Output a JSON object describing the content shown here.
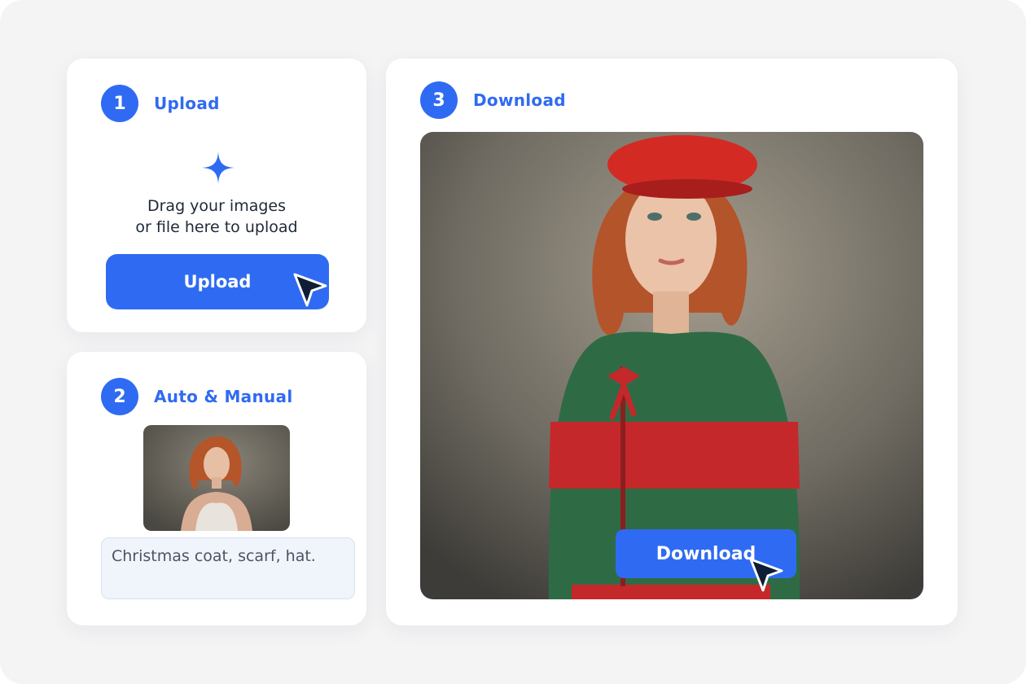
{
  "steps": [
    {
      "number": "1",
      "title": "Upload"
    },
    {
      "number": "2",
      "title": "Auto & Manual"
    },
    {
      "number": "3",
      "title": "Download"
    }
  ],
  "upload": {
    "drag_line1": "Drag your images",
    "drag_line2": "or file here to upload",
    "button_label": "Upload",
    "icon": "plus-sparkle-icon"
  },
  "manual": {
    "prompt_value": "Christmas coat, scarf, hat."
  },
  "download": {
    "button_label": "Download"
  },
  "colors": {
    "accent": "#2f6bf2",
    "background": "#f4f4f5",
    "card": "#ffffff",
    "cursor": "#0f1e35"
  }
}
